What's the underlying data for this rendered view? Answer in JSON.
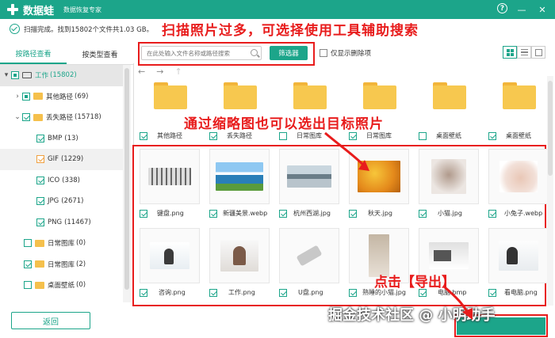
{
  "titlebar": {
    "app_name": "数据蛙",
    "subtitle": "数据恢复专家",
    "help_icon": "question-icon",
    "minimize_icon": "minimize-icon",
    "close_icon": "close-icon",
    "help_label": "?",
    "minimize_label": "—",
    "close_label": "✕"
  },
  "status": {
    "text": "扫描完成。找到15802个文件共1.03 GB。"
  },
  "annotations": {
    "top": "扫描照片过多，可选择使用工具辅助搜索",
    "middle": "通过缩略图也可以选出目标照片",
    "export": "点击【导出】",
    "watermark": "掘金技术社区 @ 小明助手"
  },
  "left_tabs": [
    {
      "label": "按路径查看",
      "active": true
    },
    {
      "label": "按类型查看",
      "active": false
    }
  ],
  "tree": [
    {
      "label": "工作",
      "count": "(15802)",
      "caret": "▾",
      "level": 0
    },
    {
      "label": "其他路径",
      "count": "(69)",
      "caret": "›",
      "level": 1
    },
    {
      "label": "丢失路径",
      "count": "(15718)",
      "caret": "⌄",
      "level": 1
    },
    {
      "label": "BMP",
      "count": "(13)",
      "level": 2
    },
    {
      "label": "GIF",
      "count": "(1229)",
      "level": 2
    },
    {
      "label": "ICO",
      "count": "(338)",
      "level": 2
    },
    {
      "label": "JPG",
      "count": "(2671)",
      "level": 2
    },
    {
      "label": "PNG",
      "count": "(11467)",
      "level": 2
    },
    {
      "label": "日常图库",
      "count": "(0)",
      "level": 1
    },
    {
      "label": "日常图库",
      "count": "(2)",
      "level": 1
    },
    {
      "label": "桌面壁纸",
      "count": "(0)",
      "level": 1
    }
  ],
  "back_button": "返回",
  "toolbar": {
    "search_placeholder": "在此处输入文件名称或路径搜索",
    "filter_label": "筛选器",
    "only_deleted_label": "仅显示删除项"
  },
  "nav": {
    "back": "←",
    "forward": "→",
    "up": "↑"
  },
  "folders": [
    {
      "label": "其他路径",
      "checked": true
    },
    {
      "label": "丢失路径",
      "checked": true
    },
    {
      "label": "日常图库",
      "checked": false
    },
    {
      "label": "日常图库",
      "checked": true
    },
    {
      "label": "桌面壁纸",
      "checked": false
    },
    {
      "label": "桌面壁纸",
      "checked": true
    }
  ],
  "thumbnails": [
    {
      "label": "键盘.png",
      "kind": "keyboard"
    },
    {
      "label": "新疆美景.webp",
      "kind": "lake"
    },
    {
      "label": "杭州西湖.jpg",
      "kind": "xihu"
    },
    {
      "label": "秋天.jpg",
      "kind": "autumn"
    },
    {
      "label": "小猫.jpg",
      "kind": "cat"
    },
    {
      "label": "小兔子.webp",
      "kind": "rabbit"
    },
    {
      "label": "咨询.png",
      "kind": "consult"
    },
    {
      "label": "工作.png",
      "kind": "work"
    },
    {
      "label": "U盘.png",
      "kind": "udisk"
    },
    {
      "label": "熟睡的小猫.jpg",
      "kind": "kitten"
    },
    {
      "label": "电脑.bmp",
      "kind": "computer"
    },
    {
      "label": "看电脑.png",
      "kind": "watch"
    }
  ],
  "colors": {
    "accent": "#1ca58a",
    "annotation": "#e81c1c",
    "folder": "#f7c84f"
  }
}
